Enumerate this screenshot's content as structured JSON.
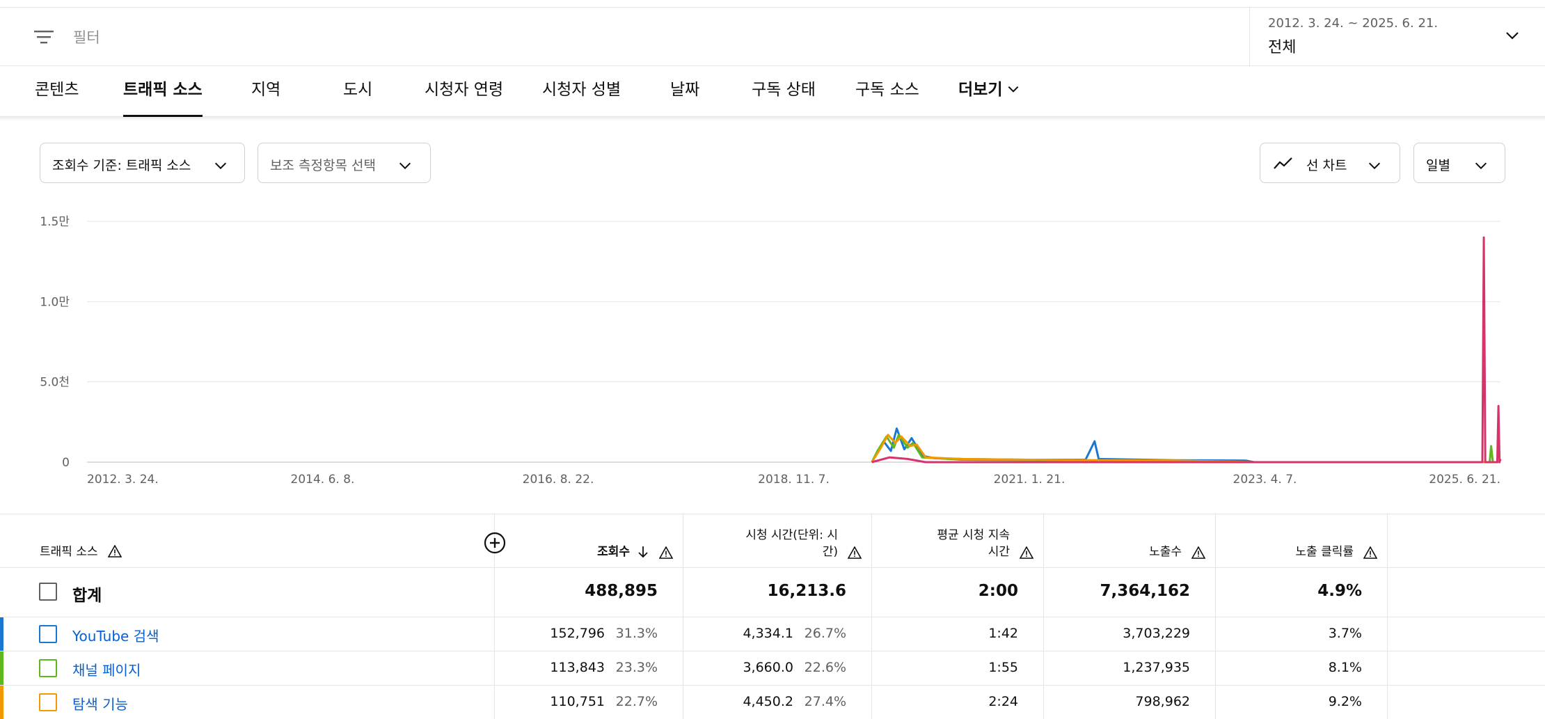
{
  "topbar": {
    "filter_label": "필터",
    "date_range": "2012. 3. 24. ~ 2025. 6. 21.",
    "date_period": "전체"
  },
  "tabs": [
    {
      "label": "콘텐츠",
      "active": false
    },
    {
      "label": "트래픽 소스",
      "active": true
    },
    {
      "label": "지역",
      "active": false
    },
    {
      "label": "도시",
      "active": false
    },
    {
      "label": "시청자 연령",
      "active": false
    },
    {
      "label": "시청자 성별",
      "active": false
    },
    {
      "label": "날짜",
      "active": false
    },
    {
      "label": "구독 상태",
      "active": false
    },
    {
      "label": "구독 소스",
      "active": false
    },
    {
      "label": "더보기",
      "active": false
    }
  ],
  "controls": {
    "metric": "조회수 기준: 트래픽 소스",
    "secondary_metric": "보조 측정항목 선택",
    "chart_type": "선 차트",
    "granularity": "일별"
  },
  "chart_data": {
    "type": "line",
    "y_ticks": [
      "1.5만",
      "1.0만",
      "5.0천",
      "0"
    ],
    "y_tick_values": [
      15000,
      10000,
      5000,
      0
    ],
    "ylim": [
      0,
      15000
    ],
    "x_ticks": [
      "2012. 3. 24.",
      "2014. 6. 8.",
      "2016. 8. 22.",
      "2018. 11. 7.",
      "2021. 1. 21.",
      "2023. 4. 7.",
      "2025. 6. 21."
    ],
    "x_range": [
      "2012-03-24",
      "2025-06-21"
    ],
    "grid": true,
    "series": [
      {
        "name": "YouTube 검색",
        "color": "#1976d2",
        "points": [
          [
            "2019-08-01",
            0
          ],
          [
            "2019-08-15",
            500
          ],
          [
            "2019-09-10",
            1300
          ],
          [
            "2019-10-05",
            700
          ],
          [
            "2019-10-25",
            2100
          ],
          [
            "2019-11-20",
            800
          ],
          [
            "2019-12-15",
            1500
          ],
          [
            "2020-01-20",
            400
          ],
          [
            "2020-03-01",
            250
          ],
          [
            "2020-06-01",
            200
          ],
          [
            "2021-01-01",
            150
          ],
          [
            "2021-08-01",
            150
          ],
          [
            "2021-09-01",
            1300
          ],
          [
            "2021-09-15",
            200
          ],
          [
            "2022-06-01",
            120
          ],
          [
            "2023-02-01",
            100
          ],
          [
            "2023-03-01",
            0
          ],
          [
            "2025-06-21",
            0
          ]
        ]
      },
      {
        "name": "채널 페이지",
        "color": "#5fb71f",
        "points": [
          [
            "2019-08-01",
            0
          ],
          [
            "2019-08-20",
            700
          ],
          [
            "2019-09-20",
            1600
          ],
          [
            "2019-10-15",
            900
          ],
          [
            "2019-11-01",
            1700
          ],
          [
            "2019-12-01",
            900
          ],
          [
            "2019-12-20",
            1200
          ],
          [
            "2020-01-20",
            300
          ],
          [
            "2020-06-01",
            150
          ],
          [
            "2021-06-01",
            120
          ],
          [
            "2022-06-01",
            100
          ],
          [
            "2023-03-01",
            0
          ],
          [
            "2025-05-15",
            0
          ],
          [
            "2025-05-20",
            1000
          ],
          [
            "2025-05-26",
            0
          ],
          [
            "2025-06-21",
            0
          ]
        ]
      },
      {
        "name": "탐색 기능",
        "color": "#f29900",
        "points": [
          [
            "2019-08-01",
            0
          ],
          [
            "2019-09-01",
            900
          ],
          [
            "2019-09-25",
            1700
          ],
          [
            "2019-10-20",
            1200
          ],
          [
            "2019-11-10",
            1600
          ],
          [
            "2019-12-10",
            1000
          ],
          [
            "2020-01-01",
            1100
          ],
          [
            "2020-02-01",
            300
          ],
          [
            "2020-06-01",
            200
          ],
          [
            "2021-06-01",
            130
          ],
          [
            "2022-06-01",
            100
          ],
          [
            "2023-03-01",
            0
          ],
          [
            "2025-06-21",
            0
          ]
        ]
      },
      {
        "name": "",
        "color": "#d6336c",
        "points": [
          [
            "2019-08-01",
            0
          ],
          [
            "2019-10-01",
            300
          ],
          [
            "2019-12-01",
            200
          ],
          [
            "2020-02-01",
            0
          ],
          [
            "2025-04-20",
            0
          ],
          [
            "2025-04-25",
            14000
          ],
          [
            "2025-04-30",
            0
          ],
          [
            "2025-06-10",
            0
          ],
          [
            "2025-06-14",
            3500
          ],
          [
            "2025-06-18",
            0
          ],
          [
            "2025-06-21",
            200
          ]
        ]
      }
    ]
  },
  "table": {
    "header_dim": "트래픽 소스",
    "columns": [
      "조회수",
      "시청 시간(단위: 시간)",
      "평균 시청 지속 시간",
      "노출수",
      "노출 클릭률"
    ],
    "column_lines": [
      [
        "조회수"
      ],
      [
        "시청 시간(단위: 시",
        "간)"
      ],
      [
        "평균 시청 지속",
        "시간"
      ],
      [
        "노출수"
      ],
      [
        "노출 클릭률"
      ]
    ],
    "total": {
      "label": "합계",
      "views": "488,895",
      "watch": "16,213.6",
      "avg": "2:00",
      "impr": "7,364,162",
      "ctr": "4.9%"
    },
    "rows": [
      {
        "name": "YouTube 검색",
        "color": "#1976d2",
        "views": "152,796",
        "views_pct": "31.3%",
        "watch": "4,334.1",
        "watch_pct": "26.7%",
        "avg": "1:42",
        "impr": "3,703,229",
        "ctr": "3.7%"
      },
      {
        "name": "채널 페이지",
        "color": "#5fb71f",
        "views": "113,843",
        "views_pct": "23.3%",
        "watch": "3,660.0",
        "watch_pct": "22.6%",
        "avg": "1:55",
        "impr": "1,237,935",
        "ctr": "8.1%"
      },
      {
        "name": "탐색 기능",
        "color": "#f29900",
        "views": "110,751",
        "views_pct": "22.7%",
        "watch": "4,450.2",
        "watch_pct": "27.4%",
        "avg": "2:24",
        "impr": "798,962",
        "ctr": "9.2%"
      }
    ]
  }
}
